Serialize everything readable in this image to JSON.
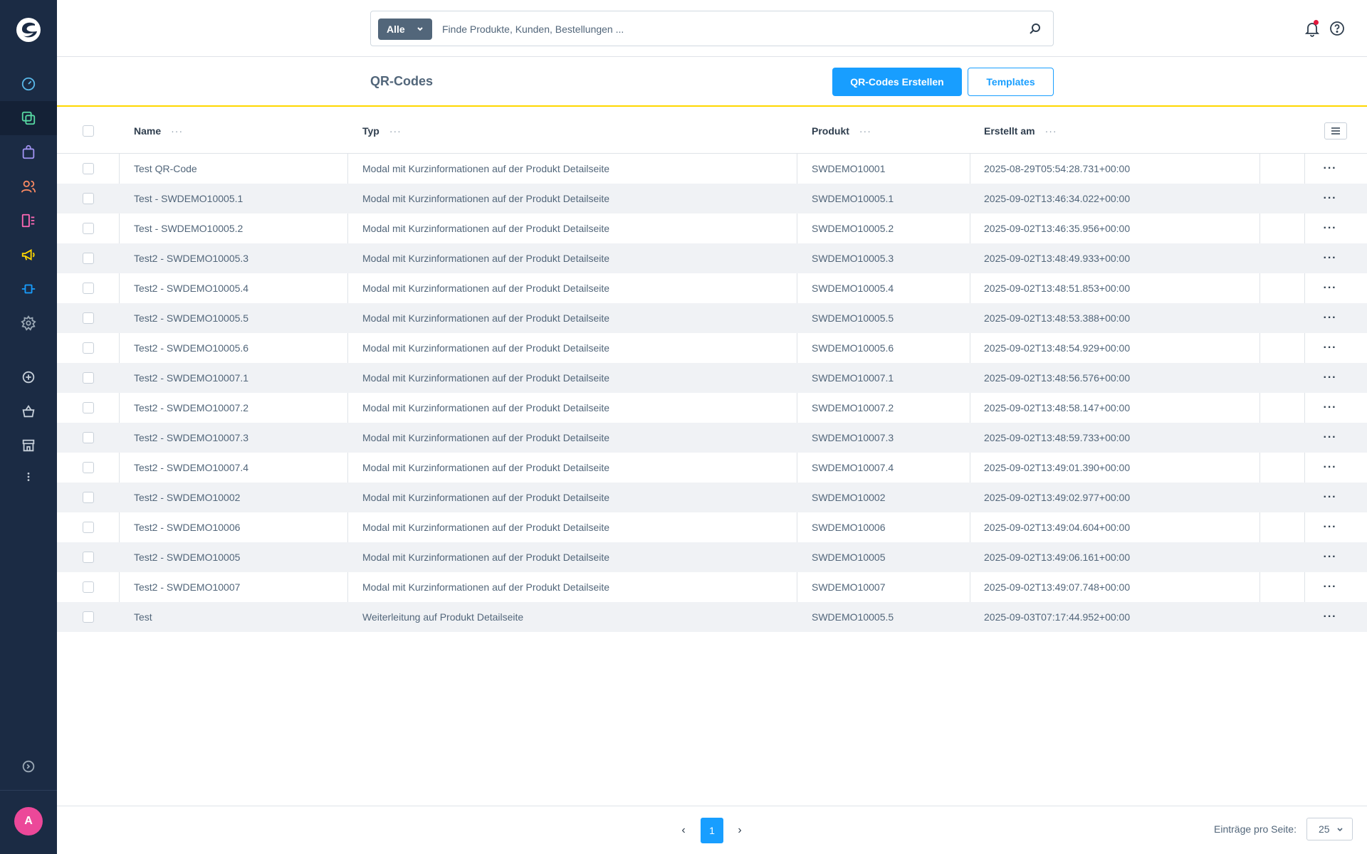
{
  "colors": {
    "sidebar": "#1b2b44",
    "accent": "#189eff",
    "header_border": "#ffd700",
    "avatar": "#ec4899",
    "notification": "#e3173b"
  },
  "sidebar": {
    "logo": "shopware-logo-icon",
    "items": [
      {
        "icon": "dashboard-icon",
        "color": "#59b7e8"
      },
      {
        "icon": "products-icon",
        "color": "#57d9a3",
        "active": true
      },
      {
        "icon": "orders-icon",
        "color": "#a092f0"
      },
      {
        "icon": "customers-icon",
        "color": "#f88962"
      },
      {
        "icon": "content-icon",
        "color": "#ff68b4"
      },
      {
        "icon": "marketing-icon",
        "color": "#ffd700"
      },
      {
        "icon": "extensions-icon",
        "color": "#189eff"
      },
      {
        "icon": "settings-icon",
        "color": "#9aa8b5"
      }
    ],
    "secondary_items": [
      {
        "icon": "add-circle-icon"
      },
      {
        "icon": "basket-icon"
      },
      {
        "icon": "store-icon"
      },
      {
        "icon": "more-vertical-icon"
      }
    ],
    "collapse_icon": "chevron-circle-right-icon",
    "avatar_initial": "A"
  },
  "search": {
    "type_label": "Alle",
    "placeholder": "Finde Produkte, Kunden, Bestellungen ..."
  },
  "page": {
    "title": "QR-Codes",
    "create_label": "QR-Codes Erstellen",
    "templates_label": "Templates"
  },
  "table": {
    "columns": {
      "name": "Name",
      "typ": "Typ",
      "produkt": "Produkt",
      "erstellt": "Erstellt am",
      "more": "···"
    },
    "rows": [
      {
        "name": "Test QR-Code",
        "typ": "Modal mit Kurzinformationen auf der Produkt Detailseite",
        "produkt": "SWDEMO10001",
        "erstellt": "2025-08-29T05:54:28.731+00:00"
      },
      {
        "name": "Test - SWDEMO10005.1",
        "typ": "Modal mit Kurzinformationen auf der Produkt Detailseite",
        "produkt": "SWDEMO10005.1",
        "erstellt": "2025-09-02T13:46:34.022+00:00"
      },
      {
        "name": "Test - SWDEMO10005.2",
        "typ": "Modal mit Kurzinformationen auf der Produkt Detailseite",
        "produkt": "SWDEMO10005.2",
        "erstellt": "2025-09-02T13:46:35.956+00:00"
      },
      {
        "name": "Test2 - SWDEMO10005.3",
        "typ": "Modal mit Kurzinformationen auf der Produkt Detailseite",
        "produkt": "SWDEMO10005.3",
        "erstellt": "2025-09-02T13:48:49.933+00:00"
      },
      {
        "name": "Test2 - SWDEMO10005.4",
        "typ": "Modal mit Kurzinformationen auf der Produkt Detailseite",
        "produkt": "SWDEMO10005.4",
        "erstellt": "2025-09-02T13:48:51.853+00:00"
      },
      {
        "name": "Test2 - SWDEMO10005.5",
        "typ": "Modal mit Kurzinformationen auf der Produkt Detailseite",
        "produkt": "SWDEMO10005.5",
        "erstellt": "2025-09-02T13:48:53.388+00:00"
      },
      {
        "name": "Test2 - SWDEMO10005.6",
        "typ": "Modal mit Kurzinformationen auf der Produkt Detailseite",
        "produkt": "SWDEMO10005.6",
        "erstellt": "2025-09-02T13:48:54.929+00:00"
      },
      {
        "name": "Test2 - SWDEMO10007.1",
        "typ": "Modal mit Kurzinformationen auf der Produkt Detailseite",
        "produkt": "SWDEMO10007.1",
        "erstellt": "2025-09-02T13:48:56.576+00:00"
      },
      {
        "name": "Test2 - SWDEMO10007.2",
        "typ": "Modal mit Kurzinformationen auf der Produkt Detailseite",
        "produkt": "SWDEMO10007.2",
        "erstellt": "2025-09-02T13:48:58.147+00:00"
      },
      {
        "name": "Test2 - SWDEMO10007.3",
        "typ": "Modal mit Kurzinformationen auf der Produkt Detailseite",
        "produkt": "SWDEMO10007.3",
        "erstellt": "2025-09-02T13:48:59.733+00:00"
      },
      {
        "name": "Test2 - SWDEMO10007.4",
        "typ": "Modal mit Kurzinformationen auf der Produkt Detailseite",
        "produkt": "SWDEMO10007.4",
        "erstellt": "2025-09-02T13:49:01.390+00:00"
      },
      {
        "name": "Test2 - SWDEMO10002",
        "typ": "Modal mit Kurzinformationen auf der Produkt Detailseite",
        "produkt": "SWDEMO10002",
        "erstellt": "2025-09-02T13:49:02.977+00:00"
      },
      {
        "name": "Test2 - SWDEMO10006",
        "typ": "Modal mit Kurzinformationen auf der Produkt Detailseite",
        "produkt": "SWDEMO10006",
        "erstellt": "2025-09-02T13:49:04.604+00:00"
      },
      {
        "name": "Test2 - SWDEMO10005",
        "typ": "Modal mit Kurzinformationen auf der Produkt Detailseite",
        "produkt": "SWDEMO10005",
        "erstellt": "2025-09-02T13:49:06.161+00:00"
      },
      {
        "name": "Test2 - SWDEMO10007",
        "typ": "Modal mit Kurzinformationen auf der Produkt Detailseite",
        "produkt": "SWDEMO10007",
        "erstellt": "2025-09-02T13:49:07.748+00:00"
      },
      {
        "name": "Test",
        "typ": "Weiterleitung auf Produkt Detailseite",
        "produkt": "SWDEMO10005.5",
        "erstellt": "2025-09-03T07:17:44.952+00:00"
      }
    ]
  },
  "pagination": {
    "prev": "‹",
    "current_page": "1",
    "next": "›",
    "per_page_label": "Einträge pro Seite:",
    "per_page_value": "25"
  }
}
